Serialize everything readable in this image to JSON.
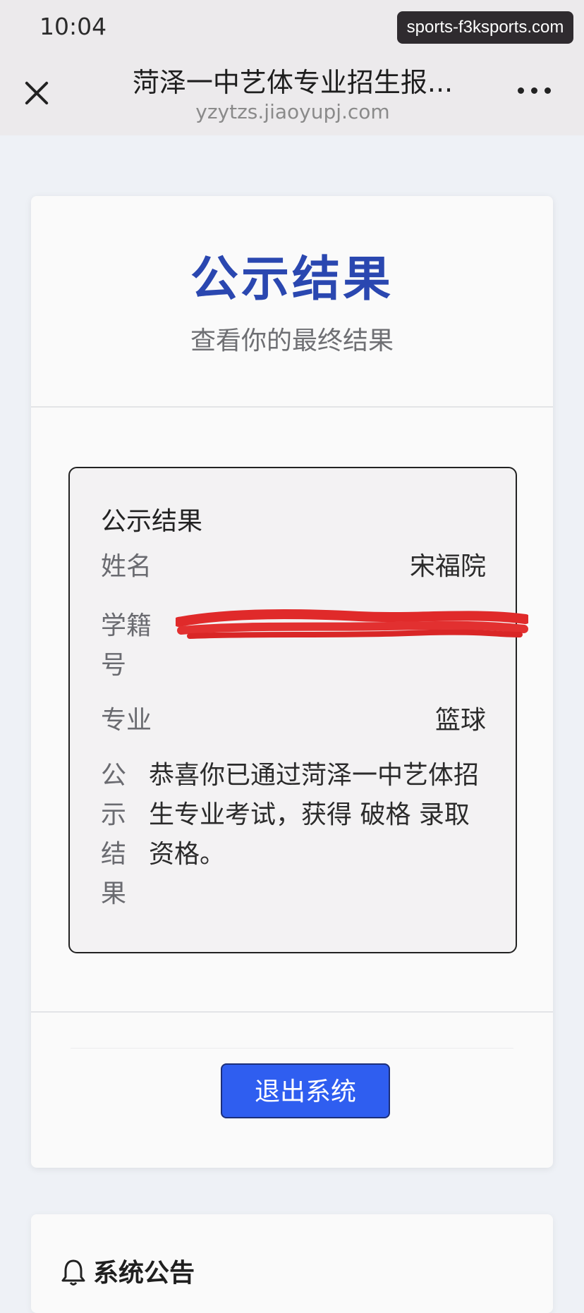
{
  "status_bar": {
    "time": "10:04",
    "watermark": "sports-f3ksports.com"
  },
  "browser": {
    "title": "菏泽一中艺体专业招生报...",
    "url": "yzytzs.jiaoyupj.com"
  },
  "card": {
    "title": "公示结果",
    "subtitle": "查看你的最终结果"
  },
  "result": {
    "heading": "公示结果",
    "name_label": "姓名",
    "name_value": "宋福院",
    "student_id_label_1": "学籍",
    "student_id_label_2": "号",
    "major_label": "专业",
    "major_value": "篮球",
    "result_label_chars": [
      "公",
      "示",
      "结",
      "果"
    ],
    "result_text": "恭喜你已通过菏泽一中艺体招生专业考试，获得 破格 录取资格。"
  },
  "exit_button": "退出系统",
  "notice": {
    "title": "系统公告",
    "icon": "bell-icon"
  },
  "colors": {
    "title_blue": "#2a47b0",
    "button_blue": "#2f5ef0",
    "redaction_red": "#e02a2a"
  }
}
